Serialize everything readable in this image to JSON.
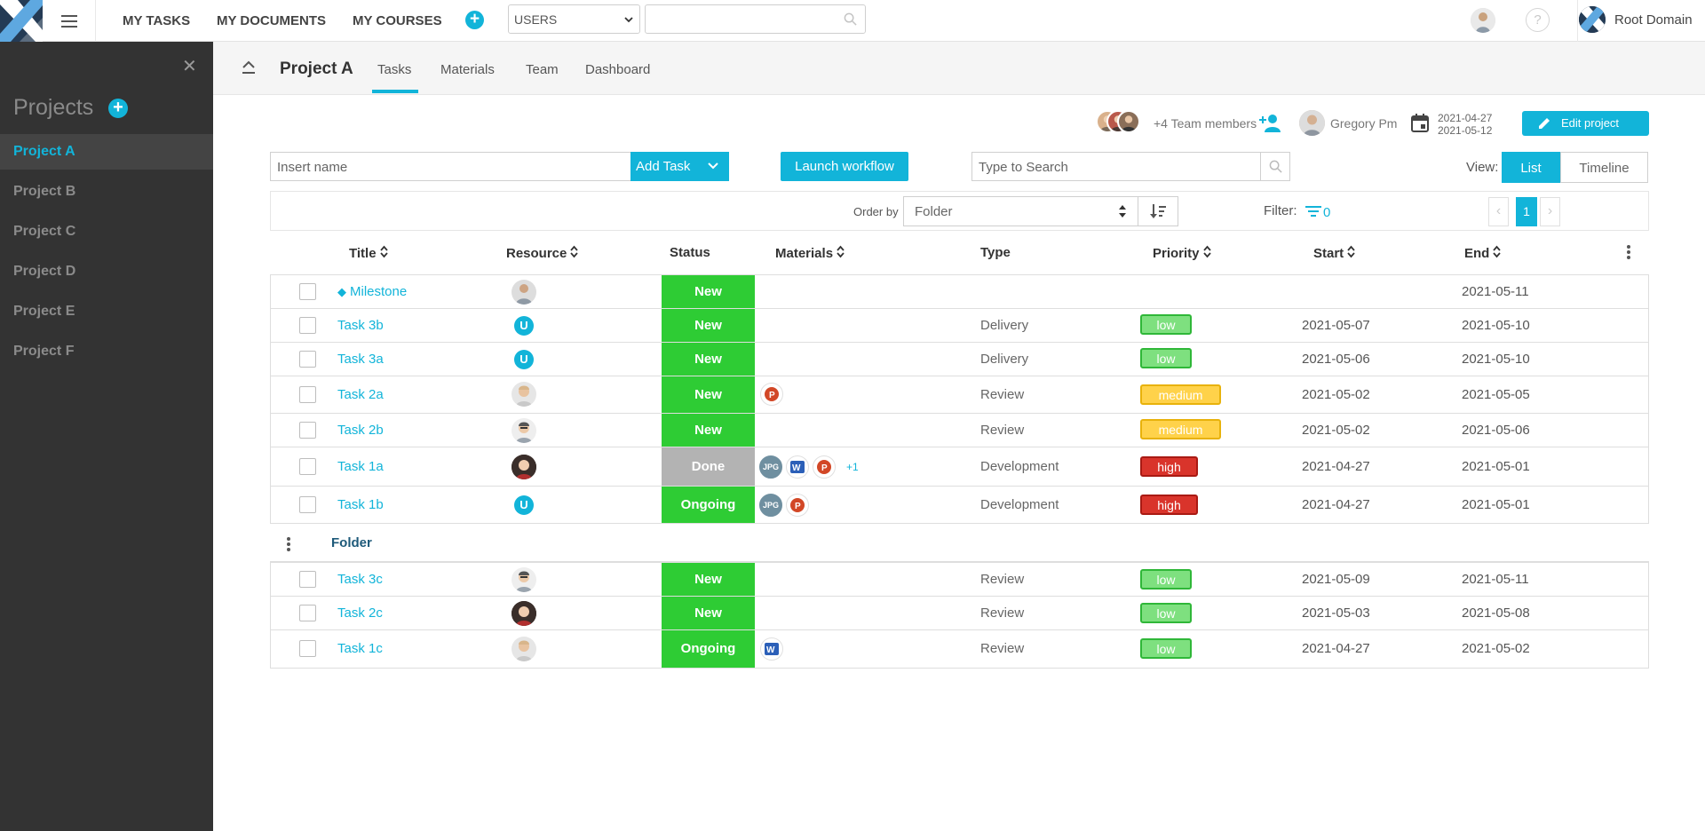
{
  "topbar": {
    "nav": [
      "MY TASKS",
      "MY DOCUMENTS",
      "MY COURSES"
    ],
    "users_select": "USERS",
    "domain": "Root Domain",
    "help": "?"
  },
  "sidebar": {
    "heading": "Projects",
    "projects": [
      "Project A",
      "Project B",
      "Project C",
      "Project D",
      "Project E",
      "Project F"
    ],
    "active": "Project A"
  },
  "project": {
    "title": "Project A",
    "tabs": [
      "Tasks",
      "Materials",
      "Team",
      "Dashboard"
    ],
    "active_tab": "Tasks",
    "team_members": "+4 Team members",
    "pm": "Gregory Pm",
    "start_date": "2021-04-27",
    "end_date": "2021-05-12",
    "edit_label": "Edit project"
  },
  "toolbar": {
    "name_placeholder": "Insert name",
    "add_task": "Add Task",
    "launch": "Launch workflow",
    "search_placeholder": "Type to Search",
    "view_label": "View:",
    "view_list": "List",
    "view_timeline": "Timeline"
  },
  "orderbar": {
    "order_label": "Order by",
    "order_value": "Folder",
    "filter_label": "Filter:",
    "filter_count": "0",
    "page": "1"
  },
  "table": {
    "headers": [
      "Title",
      "Resource",
      "Status",
      "Materials",
      "Type",
      "Priority",
      "Start",
      "End"
    ],
    "rows": [
      {
        "title": "Milestone",
        "resource": "avatar",
        "status": "New",
        "type": "",
        "priority": "",
        "start": "",
        "end": "2021-05-11"
      },
      {
        "title": "Task 3b",
        "resource": "U",
        "status": "New",
        "type": "Delivery",
        "priority": "low",
        "start": "2021-05-07",
        "end": "2021-05-10"
      },
      {
        "title": "Task 3a",
        "resource": "U",
        "status": "New",
        "type": "Delivery",
        "priority": "low",
        "start": "2021-05-06",
        "end": "2021-05-10"
      },
      {
        "title": "Task 2a",
        "resource": "avatar",
        "status": "New",
        "type": "Review",
        "priority": "medium",
        "start": "2021-05-02",
        "end": "2021-05-05"
      },
      {
        "title": "Task 2b",
        "resource": "avatar",
        "status": "New",
        "type": "Review",
        "priority": "medium",
        "start": "2021-05-02",
        "end": "2021-05-06"
      },
      {
        "title": "Task 1a",
        "resource": "avatar",
        "status": "Done",
        "type": "Development",
        "priority": "high",
        "start": "2021-04-27",
        "end": "2021-05-01",
        "mat_more": "+1"
      },
      {
        "title": "Task 1b",
        "resource": "U",
        "status": "Ongoing",
        "type": "Development",
        "priority": "high",
        "start": "2021-04-27",
        "end": "2021-05-01"
      }
    ],
    "folder": "Folder",
    "folder_rows": [
      {
        "title": "Task 3c",
        "status": "New",
        "type": "Review",
        "priority": "low",
        "start": "2021-05-09",
        "end": "2021-05-11"
      },
      {
        "title": "Task 2c",
        "status": "New",
        "type": "Review",
        "priority": "low",
        "start": "2021-05-03",
        "end": "2021-05-08"
      },
      {
        "title": "Task 1c",
        "status": "Ongoing",
        "type": "Review",
        "priority": "low",
        "start": "2021-04-27",
        "end": "2021-05-02"
      }
    ],
    "jpg_label": "JPG"
  },
  "colors": {
    "accent": "#12b4d9",
    "sidebar": "#333333",
    "status_green": "#2ecc34",
    "status_done": "#b3b3b3",
    "low": "#7ee07f",
    "medium": "#ffd24a",
    "high": "#d9342b"
  },
  "icons": [
    "menu-icon",
    "search-icon",
    "help-icon",
    "close-icon",
    "add-icon",
    "collapse-icon",
    "add-member-icon",
    "calendar-icon",
    "edit-icon",
    "chevron-down-icon",
    "sort-icon",
    "filter-icon",
    "more-icon",
    "powerpoint-icon",
    "word-icon"
  ]
}
